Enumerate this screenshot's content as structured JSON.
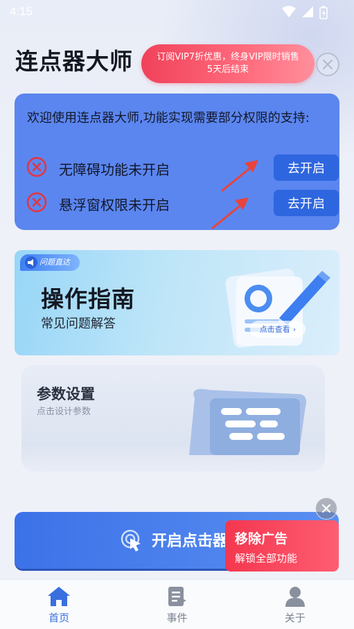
{
  "status_bar": {
    "time": "4:15"
  },
  "header": {
    "title": "连点器大师",
    "promo_line1": "订阅VIP7折优惠，终身VIP限时销售",
    "promo_line2": "5天后结束"
  },
  "permissions": {
    "intro": "欢迎使用连点器大师,功能实现需要部分权限的支持:",
    "items": [
      {
        "label": "无障碍功能未开启",
        "button": "去开启"
      },
      {
        "label": "悬浮窗权限未开启",
        "button": "去开启"
      }
    ],
    "colors": {
      "card": "#5b86ef",
      "button": "#2e66df",
      "error": "#e5343f"
    }
  },
  "guide": {
    "tag": "问题直达",
    "title": "操作指南",
    "subtitle": "常见问题解答",
    "link": "点击查看"
  },
  "params": {
    "title": "参数设置",
    "subtitle": "点击设计参数"
  },
  "start": {
    "label": "开启点击器"
  },
  "ad": {
    "title": "移除广告",
    "subtitle": "解锁全部功能"
  },
  "nav": {
    "items": [
      {
        "label": "首页",
        "icon": "home-icon",
        "active": true
      },
      {
        "label": "事件",
        "icon": "document-icon",
        "active": false
      },
      {
        "label": "关于",
        "icon": "user-icon",
        "active": false
      }
    ]
  }
}
